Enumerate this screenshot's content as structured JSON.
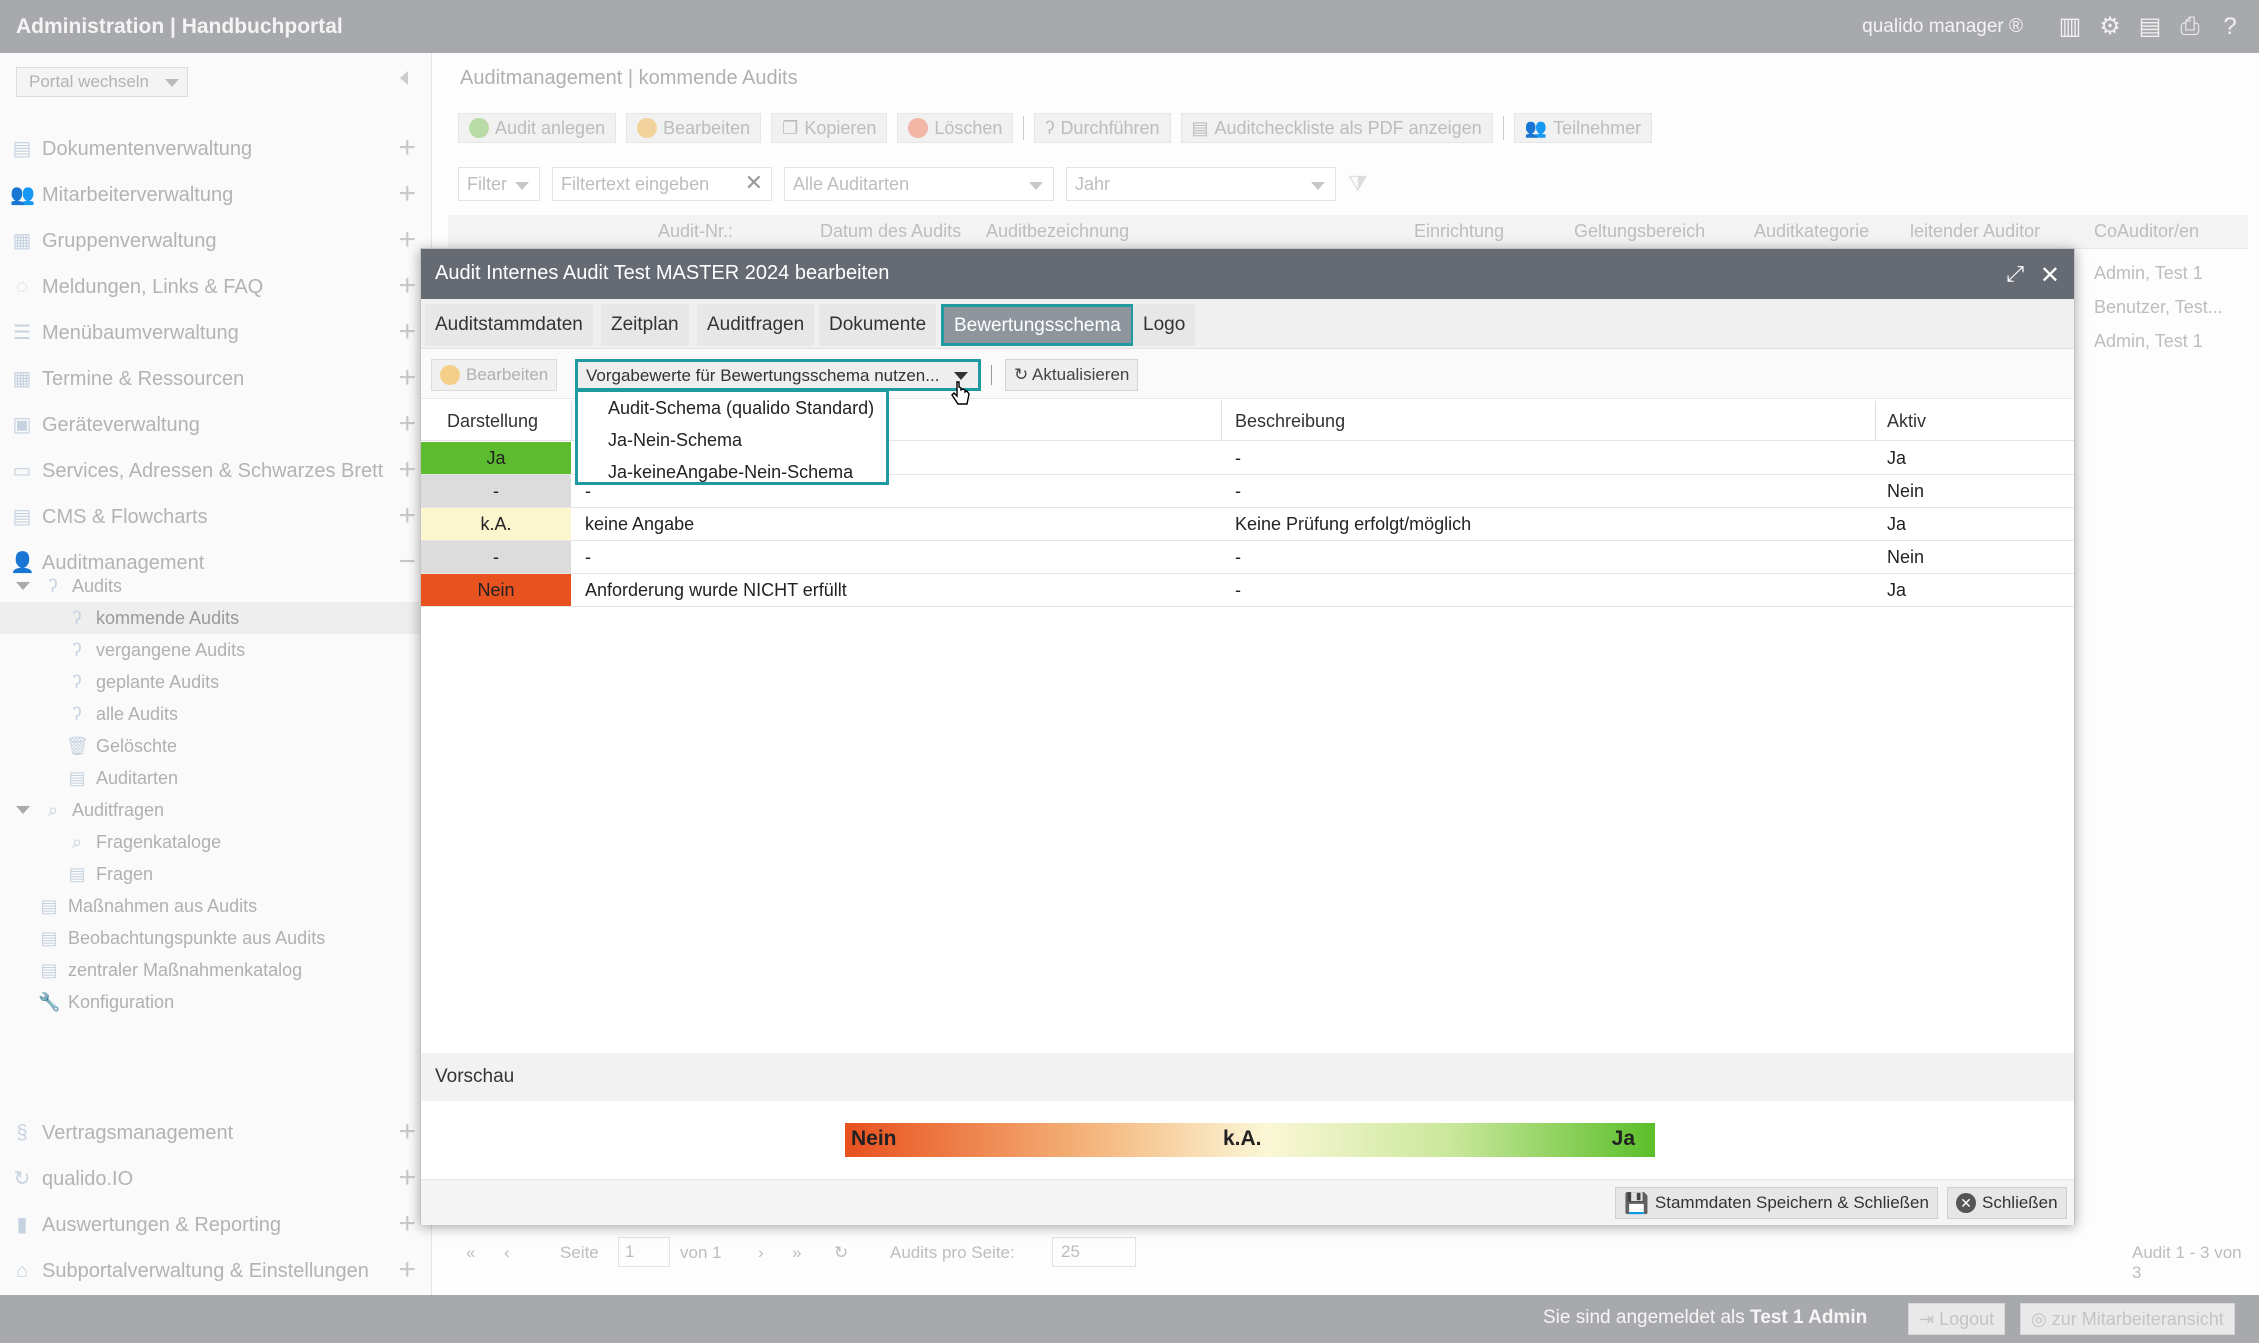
{
  "topbar": {
    "title": "Administration | Handbuchportal",
    "user": "qualido manager ®"
  },
  "sidebar": {
    "portal_select": "Portal wechseln",
    "items": [
      {
        "label": "Dokumentenverwaltung"
      },
      {
        "label": "Mitarbeiterverwaltung"
      },
      {
        "label": "Gruppenverwaltung"
      },
      {
        "label": "Meldungen, Links & FAQ"
      },
      {
        "label": "Menübaumverwaltung"
      },
      {
        "label": "Termine & Ressourcen"
      },
      {
        "label": "Geräteverwaltung"
      },
      {
        "label": "Services, Adressen & Schwarzes Brett"
      },
      {
        "label": "CMS & Flowcharts"
      },
      {
        "label": "Auditmanagement"
      }
    ],
    "tree": {
      "audits": "Audits",
      "kommende": "kommende Audits",
      "vergangene": "vergangene Audits",
      "geplante": "geplante Audits",
      "alle": "alle Audits",
      "geloeschte": "Gelöschte",
      "auditarten": "Auditarten",
      "auditfragen": "Auditfragen",
      "fragenkataloge": "Fragenkataloge",
      "fragen": "Fragen",
      "massnahmen": "Maßnahmen aus Audits",
      "beobachtung": "Beobachtungspunkte aus Audits",
      "zentral": "zentraler Maßnahmenkatalog",
      "konfiguration": "Konfiguration"
    },
    "bottom_items": [
      {
        "label": "Vertragsmanagement"
      },
      {
        "label": "qualido.IO"
      },
      {
        "label": "Auswertungen & Reporting"
      },
      {
        "label": "Subportalverwaltung & Einstellungen"
      }
    ]
  },
  "main": {
    "breadcrumb": "Auditmanagement | kommende Audits",
    "toolbar": {
      "anlegen": "Audit anlegen",
      "bearbeiten": "Bearbeiten",
      "kopieren": "Kopieren",
      "loeschen": "Löschen",
      "durchfuehren": "Durchführen",
      "pdf": "Auditcheckliste als PDF anzeigen",
      "teilnehmer": "Teilnehmer"
    },
    "filter": {
      "filter_label": "Filter",
      "text_placeholder": "Filtertext eingeben",
      "auditarten": "Alle Auditarten",
      "jahr": "Jahr"
    },
    "columns": [
      "Audit-Nr.:",
      "Datum des Audits",
      "Auditbezeichnung",
      "Einrichtung",
      "Geltungsbereich",
      "Auditkategorie",
      "leitender Auditor",
      "CoAuditor/en"
    ],
    "rows_coauditor": [
      "Admin, Test 1",
      "Benutzer, Test...",
      "Admin, Test 1"
    ],
    "pager": {
      "seite": "Seite",
      "page": "1",
      "von": "von 1",
      "pro_seite": "Audits pro Seite:",
      "per_page": "25",
      "summary": "Audit 1 - 3 von 3"
    }
  },
  "statusbar": {
    "message_prefix": "Sie sind angemeldet als",
    "user": "Test 1 Admin",
    "logout": "Logout",
    "mitarbeiter": "zur Mitarbeiteransicht"
  },
  "modal": {
    "title": "Audit Internes Audit Test MASTER 2024 bearbeiten",
    "tabs": [
      "Auditstammdaten",
      "Zeitplan",
      "Auditfragen",
      "Dokumente",
      "Bewertungsschema",
      "Logo"
    ],
    "toolbar": {
      "bearbeiten": "Bearbeiten",
      "select": "Vorgabewerte für Bewertungsschema nutzen...",
      "aktualisieren": "Aktualisieren"
    },
    "dropdown_options": [
      "Audit-Schema (qualido Standard)",
      "Ja-Nein-Schema",
      "Ja-keineAngabe-Nein-Schema"
    ],
    "columns": {
      "darstellung": "Darstellung",
      "beschreibung": "Beschreibung",
      "aktiv": "Aktiv"
    },
    "rows": [
      {
        "display": "Ja",
        "color": "#5dbb2f",
        "text": "",
        "desc": "-",
        "aktiv": "Ja"
      },
      {
        "display": "-",
        "color": "#dcdcdc",
        "text": "-",
        "desc": "-",
        "aktiv": "Nein"
      },
      {
        "display": "k.A.",
        "color": "#fbf6cd",
        "text": "keine Angabe",
        "desc": "Keine Prüfung erfolgt/möglich",
        "aktiv": "Ja"
      },
      {
        "display": "-",
        "color": "#dcdcdc",
        "text": "-",
        "desc": "-",
        "aktiv": "Nein"
      },
      {
        "display": "Nein",
        "color": "#e8521f",
        "text": "Anforderung wurde NICHT erfüllt",
        "desc": "-",
        "aktiv": "Ja"
      }
    ],
    "preview": {
      "title": "Vorschau",
      "left": "Nein",
      "mid": "k.A.",
      "right": "Ja"
    },
    "footer": {
      "save": "Stammdaten Speichern & Schließen",
      "close": "Schließen"
    }
  }
}
